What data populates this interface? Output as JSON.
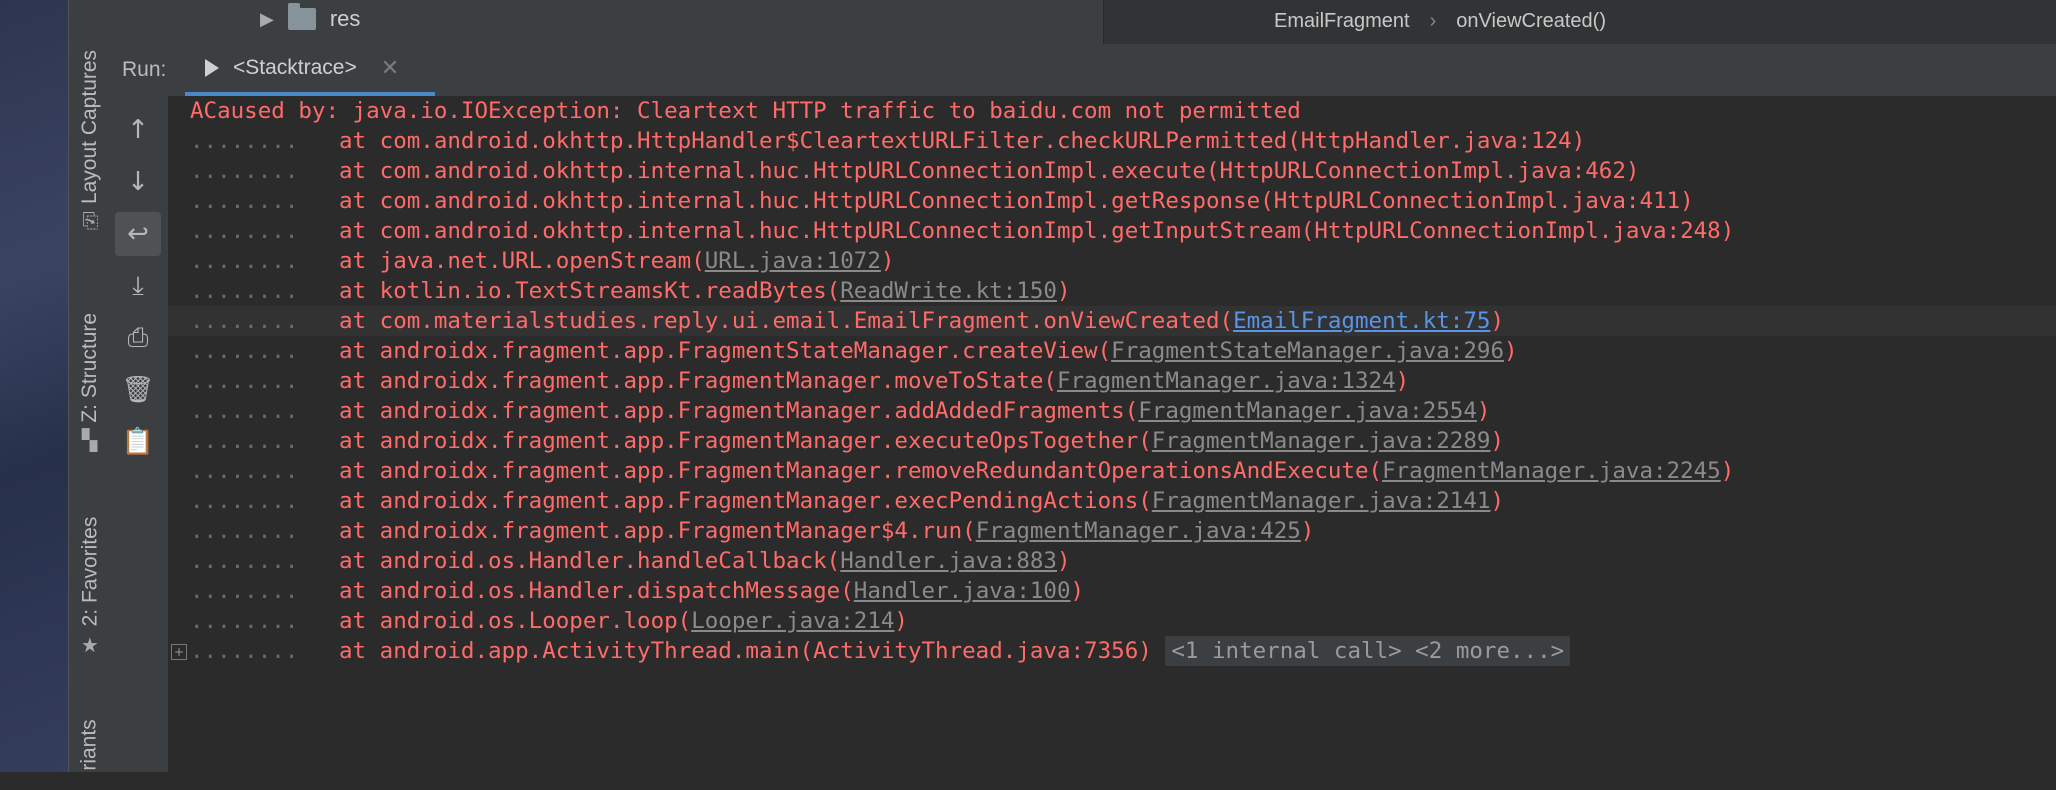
{
  "project_tree": {
    "folder_label": "res"
  },
  "breadcrumb": [
    "EmailFragment",
    "onViewCreated()"
  ],
  "side_tabs": [
    {
      "label": "Layout Captures",
      "icon": "camera-icon"
    },
    {
      "label": "Z: Structure",
      "icon": "structure-icon"
    },
    {
      "label": "2: Favorites",
      "icon": "star-icon"
    },
    {
      "label": "riants",
      "icon": ""
    }
  ],
  "run": {
    "label": "Run:",
    "tab_label": "<Stacktrace>"
  },
  "toolbar_icons": [
    "up-arrow-icon",
    "down-arrow-icon",
    "soft-wrap-icon",
    "scroll-to-end-icon",
    "print-icon",
    "trash-icon",
    "clipboard-icon"
  ],
  "console": {
    "header": "ACaused by: java.io.IOException: Cleartext HTTP traffic to baidu.com not permitted",
    "dots": "........",
    "frames": [
      {
        "prefix": "at com.android.okhttp.HttpHandler$CleartextURLFilter.checkURLPermitted(HttpHandler.java:124)"
      },
      {
        "prefix": "at com.android.okhttp.internal.huc.HttpURLConnectionImpl.execute(HttpURLConnectionImpl.java:462)"
      },
      {
        "prefix": "at com.android.okhttp.internal.huc.HttpURLConnectionImpl.getResponse(HttpURLConnectionImpl.java:411)"
      },
      {
        "prefix": "at com.android.okhttp.internal.huc.HttpURLConnectionImpl.getInputStream(HttpURLConnectionImpl.java:248)"
      },
      {
        "prefix": "at java.net.URL.openStream(",
        "link": "URL.java:1072",
        "suffix": ")"
      },
      {
        "prefix": "at kotlin.io.TextStreamsKt.readBytes(",
        "link": "ReadWrite.kt:150",
        "suffix": ")"
      },
      {
        "prefix": "at com.materialstudies.reply.ui.email.EmailFragment.onViewCreated(",
        "link": "EmailFragment.kt:75",
        "suffix": ")",
        "blue": true,
        "highlight": true
      },
      {
        "prefix": "at androidx.fragment.app.FragmentStateManager.createView(",
        "link": "FragmentStateManager.java:296",
        "suffix": ")"
      },
      {
        "prefix": "at androidx.fragment.app.FragmentManager.moveToState(",
        "link": "FragmentManager.java:1324",
        "suffix": ")"
      },
      {
        "prefix": "at androidx.fragment.app.FragmentManager.addAddedFragments(",
        "link": "FragmentManager.java:2554",
        "suffix": ")"
      },
      {
        "prefix": "at androidx.fragment.app.FragmentManager.executeOpsTogether(",
        "link": "FragmentManager.java:2289",
        "suffix": ")"
      },
      {
        "prefix": "at androidx.fragment.app.FragmentManager.removeRedundantOperationsAndExecute(",
        "link": "FragmentManager.java:2245",
        "suffix": ")"
      },
      {
        "prefix": "at androidx.fragment.app.FragmentManager.execPendingActions(",
        "link": "FragmentManager.java:2141",
        "suffix": ")"
      },
      {
        "prefix": "at androidx.fragment.app.FragmentManager$4.run(",
        "link": "FragmentManager.java:425",
        "suffix": ")"
      },
      {
        "prefix": "at android.os.Handler.handleCallback(",
        "link": "Handler.java:883",
        "suffix": ")"
      },
      {
        "prefix": "at android.os.Handler.dispatchMessage(",
        "link": "Handler.java:100",
        "suffix": ")"
      },
      {
        "prefix": "at android.os.Looper.loop(",
        "link": "Looper.java:214",
        "suffix": ")"
      },
      {
        "prefix": "at android.app.ActivityThread.main(ActivityThread.java:7356)",
        "pill": "<1 internal call> <2 more...>",
        "fold": "+"
      }
    ]
  }
}
